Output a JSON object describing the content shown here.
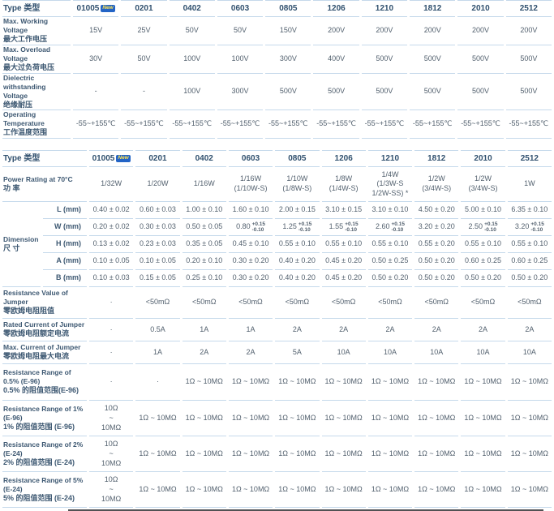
{
  "badge": {
    "label": "New",
    "bg": "#2364c6",
    "fg": "#ffe353"
  },
  "colors": {
    "accent_border": "#c5d9eb",
    "label_text": "#3d5872",
    "value_text": "#515f6d",
    "next_section_line": "#515254"
  },
  "columns": [
    "01005",
    "0201",
    "0402",
    "0603",
    "0805",
    "1206",
    "1210",
    "1812",
    "2010",
    "2512"
  ],
  "table1": {
    "header_label": "Type 类型",
    "new_badge_column": 0,
    "rows": [
      {
        "label_en": "Max. Working Voltage",
        "label_zh": "最大工作电压",
        "values": [
          "15V",
          "25V",
          "50V",
          "50V",
          "150V",
          "200V",
          "200V",
          "200V",
          "200V",
          "200V"
        ]
      },
      {
        "label_en": "Max. Overload Voltage",
        "label_zh": "最大过负荷电压",
        "values": [
          "30V",
          "50V",
          "100V",
          "100V",
          "300V",
          "400V",
          "500V",
          "500V",
          "500V",
          "500V"
        ]
      },
      {
        "label_en": "Dielectric withstanding Voltage",
        "label_zh": "绝缘耐压",
        "values": [
          "-",
          "-",
          "100V",
          "300V",
          "500V",
          "500V",
          "500V",
          "500V",
          "500V",
          "500V"
        ]
      },
      {
        "label_en": "Operating Temperature",
        "label_zh": "工作温度范围",
        "values": [
          "-55~+155℃",
          "-55~+155℃",
          "-55~+155℃",
          "-55~+155℃",
          "-55~+155℃",
          "-55~+155℃",
          "-55~+155℃",
          "-55~+155℃",
          "-55~+155℃",
          "-55~+155℃"
        ]
      }
    ]
  },
  "table2": {
    "header_label": "Type 类型",
    "new_badge_column": 0,
    "power_row": {
      "label_en": "Power Rating at 70°C",
      "label_zh": "功 率",
      "values": [
        "1/32W",
        "1/20W",
        "1/16W",
        "1/16W\n(1/10W-S)",
        "1/10W\n(1/8W-S)",
        "1/8W\n(1/4W-S)",
        "1/4W\n(1/3W-S\n1/2W-SS) *",
        "1/2W\n(3/4W-S)",
        "1/2W\n(3/4W-S)",
        "1W"
      ]
    },
    "dimension": {
      "label_en": "Dimension",
      "label_zh": "尺 寸",
      "rows": [
        {
          "sub": "L (mm)",
          "values": [
            "0.40 ± 0.02",
            "0.60 ± 0.03",
            "1.00 ± 0.10",
            "1.60 ± 0.10",
            "2.00 ± 0.15",
            "3.10 ± 0.15",
            "3.10 ± 0.10",
            "4.50 ± 0.20",
            "5.00 ± 0.10",
            "6.35 ± 0.10"
          ]
        },
        {
          "sub": "W (mm)",
          "values": [
            "0.20 ± 0.02",
            "0.30 ± 0.03",
            "0.50 ± 0.05",
            {
              "v": "0.80",
              "plus": "+0.15",
              "minus": "-0.10"
            },
            {
              "v": "1.25",
              "plus": "+0.15",
              "minus": "-0.10"
            },
            {
              "v": "1.55",
              "plus": "+0.15",
              "minus": "-0.10"
            },
            {
              "v": "2.60",
              "plus": "+0.15",
              "minus": "-0.10"
            },
            "3.20 ± 0.20",
            {
              "v": "2.50",
              "plus": "+0.15",
              "minus": "-0.10"
            },
            {
              "v": "3.20",
              "plus": "+0.15",
              "minus": "-0.10"
            }
          ]
        },
        {
          "sub": "H (mm)",
          "values": [
            "0.13 ± 0.02",
            "0.23 ± 0.03",
            "0.35 ± 0.05",
            "0.45 ± 0.10",
            "0.55 ± 0.10",
            "0.55 ± 0.10",
            "0.55 ± 0.10",
            "0.55 ± 0.20",
            "0.55 ± 0.10",
            "0.55 ± 0.10"
          ]
        },
        {
          "sub": "A (mm)",
          "values": [
            "0.10 ± 0.05",
            "0.10 ± 0.05",
            "0.20 ± 0.10",
            "0.30 ± 0.20",
            "0.40 ± 0.20",
            "0.45 ± 0.20",
            "0.50 ± 0.25",
            "0.50 ± 0.20",
            "0.60 ± 0.25",
            "0.60 ± 0.25"
          ]
        },
        {
          "sub": "B (mm)",
          "values": [
            "0.10 ± 0.03",
            "0.15 ± 0.05",
            "0.25 ± 0.10",
            "0.30 ± 0.20",
            "0.40 ± 0.20",
            "0.45 ± 0.20",
            "0.50 ± 0.20",
            "0.50 ± 0.20",
            "0.50 ± 0.20",
            "0.50 ± 0.20"
          ]
        }
      ]
    },
    "rows": [
      {
        "label_en": "Resistance Value of Jumper",
        "label_zh": "零欧姆电阻阻值",
        "values": [
          "·",
          "<50mΩ",
          "<50mΩ",
          "<50mΩ",
          "<50mΩ",
          "<50mΩ",
          "<50mΩ",
          "<50mΩ",
          "<50mΩ",
          "<50mΩ"
        ]
      },
      {
        "label_en": "Rated Current of Jumper",
        "label_zh": "零欧姆电阻额定电流",
        "values": [
          "·",
          "0.5A",
          "1A",
          "1A",
          "2A",
          "2A",
          "2A",
          "2A",
          "2A",
          "2A"
        ]
      },
      {
        "label_en": "Max. Current of Jumper",
        "label_zh": "零欧姆电阻最大电流",
        "values": [
          "·",
          "1A",
          "2A",
          "2A",
          "5A",
          "10A",
          "10A",
          "10A",
          "10A",
          "10A"
        ]
      },
      {
        "label_en": "Resistance Range of 0.5% (E-96)",
        "label_zh": "0.5% 的阻值范围(E-96)",
        "values": [
          "·",
          "·",
          "1Ω ~ 10MΩ",
          "1Ω ~ 10MΩ",
          "1Ω ~ 10MΩ",
          "1Ω ~ 10MΩ",
          "1Ω ~ 10MΩ",
          "1Ω ~ 10MΩ",
          "1Ω ~ 10MΩ",
          "1Ω ~ 10MΩ"
        ]
      },
      {
        "label_en": "Resistance Range of 1% (E-96)",
        "label_zh": "1% 的阻值范围 (E-96)",
        "values": [
          "10Ω\n~\n10MΩ",
          "1Ω ~ 10MΩ",
          "1Ω ~ 10MΩ",
          "1Ω ~ 10MΩ",
          "1Ω ~ 10MΩ",
          "1Ω ~ 10MΩ",
          "1Ω ~ 10MΩ",
          "1Ω ~ 10MΩ",
          "1Ω ~ 10MΩ",
          "1Ω ~ 10MΩ"
        ]
      },
      {
        "label_en": "Resistance Range of 2% (E-24)",
        "label_zh": "2% 的阻值范围 (E-24)",
        "values": [
          "10Ω\n~\n10MΩ",
          "1Ω ~ 10MΩ",
          "1Ω ~ 10MΩ",
          "1Ω ~ 10MΩ",
          "1Ω ~ 10MΩ",
          "1Ω ~ 10MΩ",
          "1Ω ~ 10MΩ",
          "1Ω ~ 10MΩ",
          "1Ω ~ 10MΩ",
          "1Ω ~ 10MΩ"
        ]
      },
      {
        "label_en": "Resistance Range of 5% (E-24)",
        "label_zh": "5% 的阻值范围 (E-24)",
        "values": [
          "10Ω\n~\n10MΩ",
          "1Ω ~ 10MΩ",
          "1Ω ~ 10MΩ",
          "1Ω ~ 10MΩ",
          "1Ω ~ 10MΩ",
          "1Ω ~ 10MΩ",
          "1Ω ~ 10MΩ",
          "1Ω ~ 10MΩ",
          "1Ω ~ 10MΩ",
          "1Ω ~ 10MΩ"
        ]
      }
    ]
  }
}
